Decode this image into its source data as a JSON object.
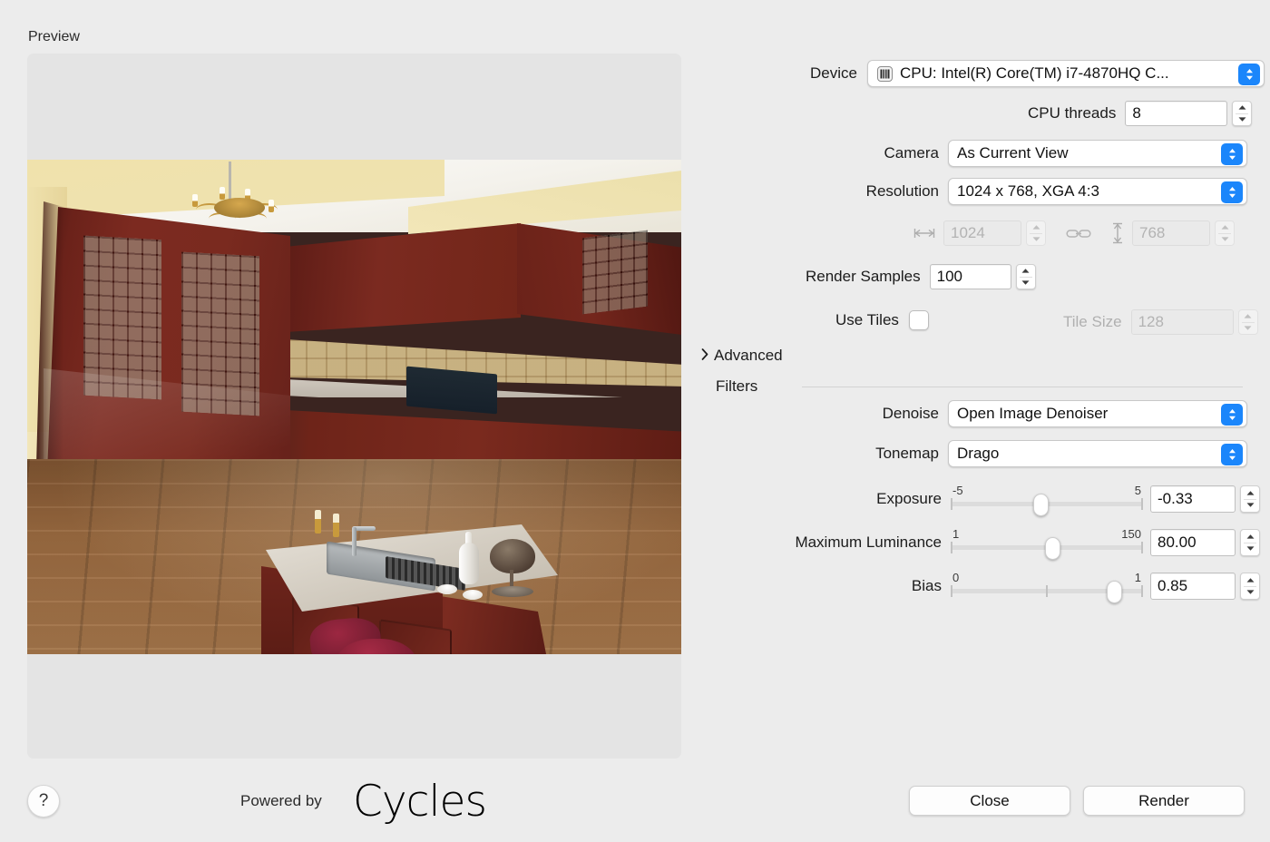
{
  "preview": {
    "label": "Preview",
    "scene_description": "3D rendered kitchen interior with dark cherry wood cabinetry, tiled backsplash, marble-top island, two red bar stools and hardwood floor"
  },
  "settings": {
    "device": {
      "label": "Device",
      "value": "CPU: Intel(R) Core(TM) i7-4870HQ C...",
      "icon": "cpu-chip-icon"
    },
    "cpu_threads": {
      "label": "CPU threads",
      "value": "8"
    },
    "camera": {
      "label": "Camera",
      "value": "As Current View"
    },
    "resolution": {
      "label": "Resolution",
      "value": "1024 x 768, XGA 4:3"
    },
    "width": {
      "value": "1024",
      "icon": "width-arrows-icon",
      "disabled": true
    },
    "link": {
      "icon": "link-chain-icon"
    },
    "height": {
      "value": "768",
      "icon": "height-arrow-icon",
      "disabled": true
    },
    "render_samples": {
      "label": "Render Samples",
      "value": "100"
    },
    "use_tiles": {
      "label": "Use Tiles",
      "checked": false
    },
    "tile_size": {
      "label": "Tile Size",
      "value": "128",
      "disabled": true
    },
    "advanced": {
      "label": "Advanced",
      "expanded": false
    },
    "filters": {
      "label": "Filters"
    },
    "denoise": {
      "label": "Denoise",
      "value": "Open Image Denoiser"
    },
    "tonemap": {
      "label": "Tonemap",
      "value": "Drago"
    },
    "exposure": {
      "label": "Exposure",
      "min": "-5",
      "max": "5",
      "value": "-0.33",
      "fraction": 0.467
    },
    "maximum_luminance": {
      "label": "Maximum Luminance",
      "min": "1",
      "max": "150",
      "value": "80.00",
      "fraction": 0.53
    },
    "bias": {
      "label": "Bias",
      "min": "0",
      "max": "1",
      "value": "0.85",
      "fraction": 0.85
    }
  },
  "footer": {
    "help": "?",
    "powered_by": "Powered by",
    "engine": "Cycles",
    "close": "Close",
    "render": "Render"
  },
  "colors": {
    "window_bg": "#ececec",
    "accent_blue": "#1b86fb",
    "preview_bg": "#e4e4e4"
  }
}
